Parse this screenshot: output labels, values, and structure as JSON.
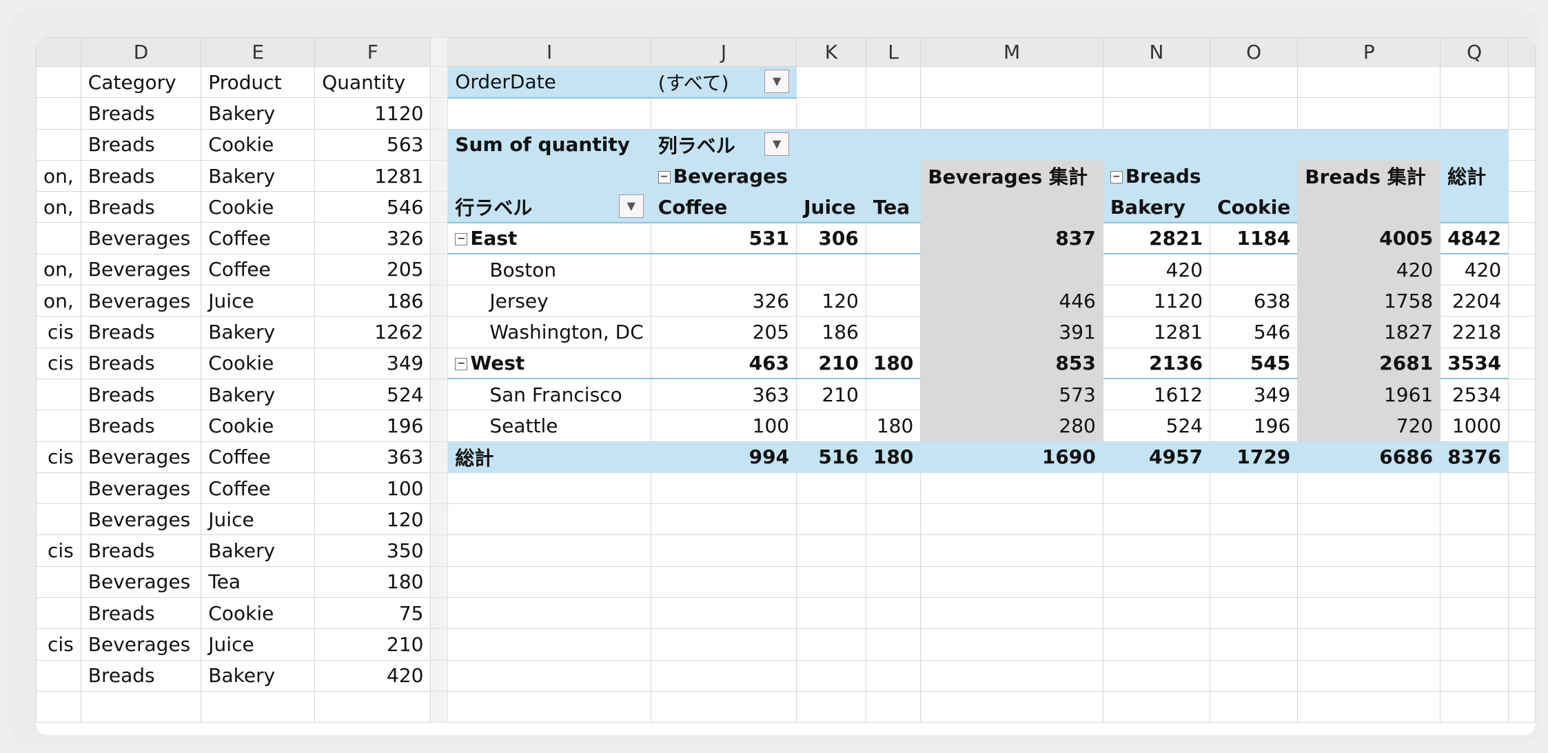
{
  "columns": [
    "D",
    "E",
    "F",
    "I",
    "J",
    "K",
    "L",
    "M",
    "N",
    "O",
    "P",
    "Q"
  ],
  "source": {
    "header": {
      "category": "Category",
      "product": "Product",
      "quantity": "Quantity"
    },
    "rows": [
      {
        "clip": "",
        "category": "Breads",
        "product": "Bakery",
        "quantity": "1120"
      },
      {
        "clip": "",
        "category": "Breads",
        "product": "Cookie",
        "quantity": "563"
      },
      {
        "clip": "on,",
        "category": "Breads",
        "product": "Bakery",
        "quantity": "1281"
      },
      {
        "clip": "on,",
        "category": "Breads",
        "product": "Cookie",
        "quantity": "546"
      },
      {
        "clip": "",
        "category": "Beverages",
        "product": "Coffee",
        "quantity": "326"
      },
      {
        "clip": "on,",
        "category": "Beverages",
        "product": "Coffee",
        "quantity": "205"
      },
      {
        "clip": "on,",
        "category": "Beverages",
        "product": "Juice",
        "quantity": "186"
      },
      {
        "clip": "cis",
        "category": "Breads",
        "product": "Bakery",
        "quantity": "1262"
      },
      {
        "clip": "cis",
        "category": "Breads",
        "product": "Cookie",
        "quantity": "349"
      },
      {
        "clip": "",
        "category": "Breads",
        "product": "Bakery",
        "quantity": "524"
      },
      {
        "clip": "",
        "category": "Breads",
        "product": "Cookie",
        "quantity": "196"
      },
      {
        "clip": "cis",
        "category": "Beverages",
        "product": "Coffee",
        "quantity": "363"
      },
      {
        "clip": "",
        "category": "Beverages",
        "product": "Coffee",
        "quantity": "100"
      },
      {
        "clip": "",
        "category": "Beverages",
        "product": "Juice",
        "quantity": "120"
      },
      {
        "clip": "cis",
        "category": "Breads",
        "product": "Bakery",
        "quantity": "350"
      },
      {
        "clip": "",
        "category": "Beverages",
        "product": "Tea",
        "quantity": "180"
      },
      {
        "clip": "",
        "category": "Breads",
        "product": "Cookie",
        "quantity": "75"
      },
      {
        "clip": "cis",
        "category": "Beverages",
        "product": "Juice",
        "quantity": "210"
      },
      {
        "clip": "",
        "category": "Breads",
        "product": "Bakery",
        "quantity": "420"
      }
    ]
  },
  "pivot": {
    "filter_label": "OrderDate",
    "filter_value": "(すべて)",
    "values_label": "Sum of quantity",
    "col_labels": "列ラベル",
    "row_labels": "行ラベル",
    "group_beverages": "Beverages",
    "group_breads": "Breads",
    "beverages_total": "Beverages 集計",
    "breads_total": "Breads 集計",
    "grand_total": "総計",
    "products": {
      "coffee": "Coffee",
      "juice": "Juice",
      "tea": "Tea",
      "bakery": "Bakery",
      "cookie": "Cookie"
    },
    "rows": [
      {
        "label": "East",
        "bold": true,
        "coffee": "531",
        "juice": "306",
        "tea": "",
        "bev": "837",
        "bakery": "2821",
        "cookie": "1184",
        "brd": "4005",
        "total": "4842"
      },
      {
        "label": "Boston",
        "bold": false,
        "coffee": "",
        "juice": "",
        "tea": "",
        "bev": "",
        "bakery": "420",
        "cookie": "",
        "brd": "420",
        "total": "420"
      },
      {
        "label": "Jersey",
        "bold": false,
        "coffee": "326",
        "juice": "120",
        "tea": "",
        "bev": "446",
        "bakery": "1120",
        "cookie": "638",
        "brd": "1758",
        "total": "2204"
      },
      {
        "label": "Washington, DC",
        "bold": false,
        "coffee": "205",
        "juice": "186",
        "tea": "",
        "bev": "391",
        "bakery": "1281",
        "cookie": "546",
        "brd": "1827",
        "total": "2218"
      },
      {
        "label": "West",
        "bold": true,
        "coffee": "463",
        "juice": "210",
        "tea": "180",
        "bev": "853",
        "bakery": "2136",
        "cookie": "545",
        "brd": "2681",
        "total": "3534"
      },
      {
        "label": "San Francisco",
        "bold": false,
        "coffee": "363",
        "juice": "210",
        "tea": "",
        "bev": "573",
        "bakery": "1612",
        "cookie": "349",
        "brd": "1961",
        "total": "2534"
      },
      {
        "label": "Seattle",
        "bold": false,
        "coffee": "100",
        "juice": "",
        "tea": "180",
        "bev": "280",
        "bakery": "524",
        "cookie": "196",
        "brd": "720",
        "total": "1000"
      }
    ],
    "grand": {
      "label": "総計",
      "coffee": "994",
      "juice": "516",
      "tea": "180",
      "bev": "1690",
      "bakery": "4957",
      "cookie": "1729",
      "brd": "6686",
      "total": "8376"
    }
  }
}
